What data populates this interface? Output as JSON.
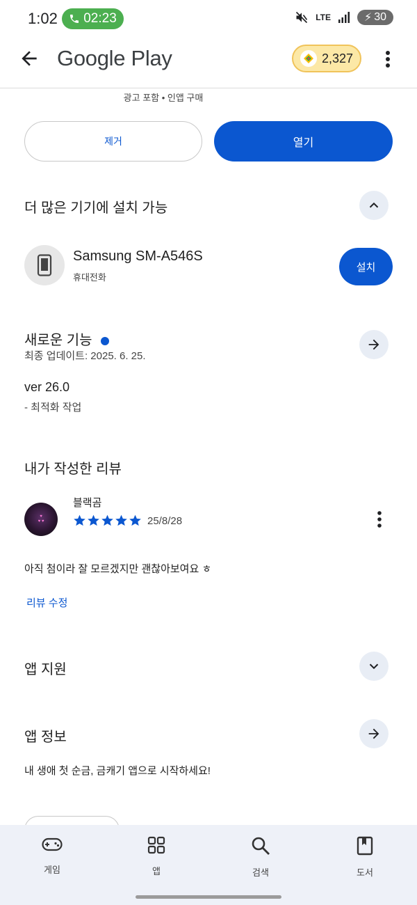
{
  "status_bar": {
    "time": "1:02",
    "call_timer": "02:23",
    "network": "LTE",
    "battery": "30"
  },
  "header": {
    "brand": "Google Play",
    "points": "2,327"
  },
  "ad_note": "광고 포함 • 인앱 구매",
  "actions": {
    "remove_label": "제거",
    "open_label": "열기"
  },
  "devices_section": {
    "title": "더 많은 기기에 설치 가능",
    "device_name": "Samsung SM-A546S",
    "device_type": "휴대전화",
    "install_label": "설치"
  },
  "whats_new": {
    "title": "새로운 기능",
    "last_update": "최종 업데이트: 2025. 6. 25.",
    "version": "ver 26.0",
    "note": "- 최적화 작업"
  },
  "my_review": {
    "title": "내가 작성한 리뷰",
    "author": "블랙곰",
    "rating": 5,
    "date": "25/8/28",
    "text": "아직 첨이라 잘 모르겠지만 괜찮아보여요 ㅎ",
    "edit_label": "리뷰 수정"
  },
  "app_support": {
    "title": "앱 지원"
  },
  "app_info": {
    "title": "앱 정보",
    "description": "내 생애 첫 순금, 금캐기 앱으로 시작하세요!"
  },
  "bottom_nav": [
    {
      "label": "게임",
      "icon": "gamepad-icon"
    },
    {
      "label": "앱",
      "icon": "apps-grid-icon"
    },
    {
      "label": "검색",
      "icon": "search-icon"
    },
    {
      "label": "도서",
      "icon": "book-icon"
    }
  ],
  "colors": {
    "accent": "#0b57d0",
    "nav_bg": "#eef1f8",
    "chip_bg": "#e8edf5",
    "call_green": "#4caf50",
    "points_bg": "#fce8a6"
  }
}
